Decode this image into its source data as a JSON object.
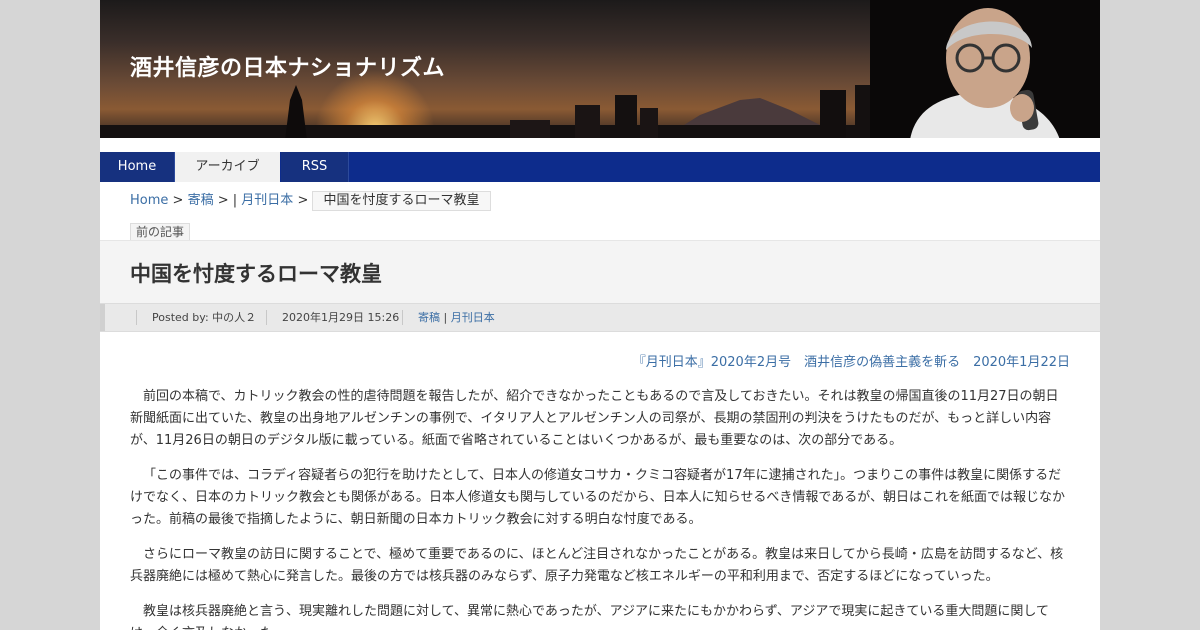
{
  "site": {
    "title": "酒井信彦の日本ナショナリズム"
  },
  "nav": {
    "home": "Home",
    "archive": "アーカイブ",
    "rss": "RSS"
  },
  "breadcrumb": {
    "home": "Home",
    "sep1": ">",
    "cat1": "寄稿",
    "sep2": "> |",
    "cat2": "月刊日本",
    "sep3": ">",
    "current": "中国を忖度するローマ教皇"
  },
  "prev_link": "前の記事",
  "article": {
    "title": "中国を忖度するローマ教皇",
    "meta": {
      "posted_by_label": "Posted by:",
      "author": "中の人２",
      "date": "2020年1月29日 15:26",
      "cat1": "寄稿",
      "cat_sep": "|",
      "cat2": "月刊日本"
    },
    "source": "『月刊日本』2020年2月号　酒井信彦の偽善主義を斬る　2020年1月22日",
    "paragraphs": [
      "前回の本稿で、カトリック教会の性的虐待問題を報告したが、紹介できなかったこともあるので言及しておきたい。それは教皇の帰国直後の11月27日の朝日新聞紙面に出ていた、教皇の出身地アルゼンチンの事例で、イタリア人とアルゼンチン人の司祭が、長期の禁固刑の判決をうけたものだが、もっと詳しい内容が、11月26日の朝日のデジタル版に載っている。紙面で省略されていることはいくつかあるが、最も重要なのは、次の部分である。",
      "「この事件では、コラディ容疑者らの犯行を助けたとして、日本人の修道女コサカ・クミコ容疑者が17年に逮捕された」。つまりこの事件は教皇に関係するだけでなく、日本のカトリック教会とも関係がある。日本人修道女も関与しているのだから、日本人に知らせるべき情報であるが、朝日はこれを紙面では報じなかった。前稿の最後で指摘したように、朝日新聞の日本カトリック教会に対する明白な忖度である。",
      "さらにローマ教皇の訪日に関することで、極めて重要であるのに、ほとんど注目されなかったことがある。教皇は来日してから長崎・広島を訪問するなど、核兵器廃絶には極めて熱心に発言した。最後の方では核兵器のみならず、原子力発電など核エネルギーの平和利用まで、否定するほどになっていった。",
      "教皇は核兵器廃絶と言う、現実離れした問題に対して、異常に熱心であったが、アジアに来たにもかかわらず、アジアで現実に起きている重大問題に関しては、全く言及しなかった。"
    ]
  },
  "colors": {
    "nav_bg": "#0d2c8c",
    "link": "#3b6ea5"
  }
}
